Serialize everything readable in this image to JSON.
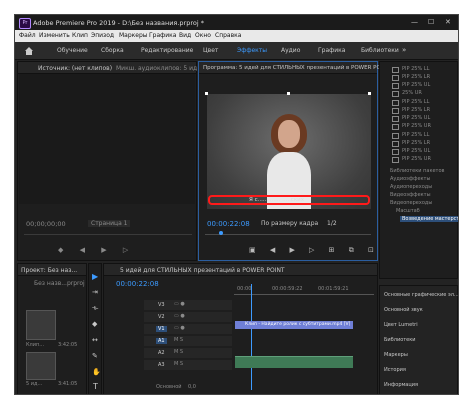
{
  "titlebar": {
    "app_icon": "Pr",
    "title": "Adobe Premiere Pro 2019 - D:\\Без названия.prproj *",
    "controls": [
      "—",
      "☐",
      "✕"
    ]
  },
  "menu": [
    "Файл",
    "Изменить",
    "Клип",
    "Эпизод",
    "Маркеры",
    "Графика",
    "Вид",
    "Окно",
    "Справка"
  ],
  "workspaces": {
    "tabs": [
      "Обучение",
      "Сборка",
      "Редактирование",
      "Цвет",
      "Эффекты",
      "Аудио",
      "Графика",
      "Библиотеки"
    ],
    "active": "Эффекты",
    "more": "»"
  },
  "source": {
    "tabs": [
      "Источник: (нет клипов)",
      "Микш. аудиоклипов: 5 ид"
    ],
    "timecode_left": "00;00;00;00",
    "page": "Страница 1"
  },
  "program": {
    "title": "Программа: 5 идей для СТИЛЬНЫХ презентаций в POWER POINT",
    "caption": "Я с...... ...... .....ских",
    "timecode": "00:00:22:08",
    "zoom": "По размеру кадра",
    "quality": "1/2"
  },
  "effects": {
    "preset_items": [
      "PIP 25% LL",
      "PIP 25% LR",
      "PIP 25% UL",
      "25% UR",
      "PIP 25% LL",
      "PIP 25% LR",
      "PIP 25% UL",
      "PIP 25% UR",
      "PIP 25% LL",
      "PIP 25% LR",
      "PIP 25% UL",
      "PIP 25% UR"
    ],
    "folders": [
      "Библиотеки пакетов",
      "Аудиоэффекты",
      "Аудиопереходы",
      "Видеоэффекты",
      "Видеопереходы"
    ],
    "subfolder": "Масштаб",
    "selected": "Возведение мастерства"
  },
  "panels_right": [
    "Основные графические эл...",
    "Основной звук",
    "Цвет Lumetri",
    "Библиотеки",
    "Маркеры",
    "История",
    "Информация"
  ],
  "project": {
    "tab": "Проект: Без наз...",
    "file": "Без назв...prproj",
    "clips": [
      {
        "name": "Клип...",
        "duration": "3:42:05"
      },
      {
        "name": "5 ид...",
        "duration": "3:41:05"
      }
    ]
  },
  "timeline": {
    "title": "5 идей для СТИЛЬНЫХ презентаций в POWER POINT",
    "timecode": "00:00:22:08",
    "ruler": [
      "00:00",
      "00:00:59:22",
      "00:01:59:21"
    ],
    "tracks": [
      "V3",
      "V2",
      "V1",
      "A1",
      "A2",
      "A3"
    ],
    "clip_label": "Клип - Найдите ролик с субтитрами.mp4 [V]",
    "master": "Основной",
    "master_value": "0,0"
  },
  "colors": {
    "accent": "#3d9bff",
    "panel": "#1e1e1e",
    "frame_highlight": "#ff1a1a",
    "clip_video": "#6f7fd6",
    "clip_audio": "#3f7a56"
  }
}
